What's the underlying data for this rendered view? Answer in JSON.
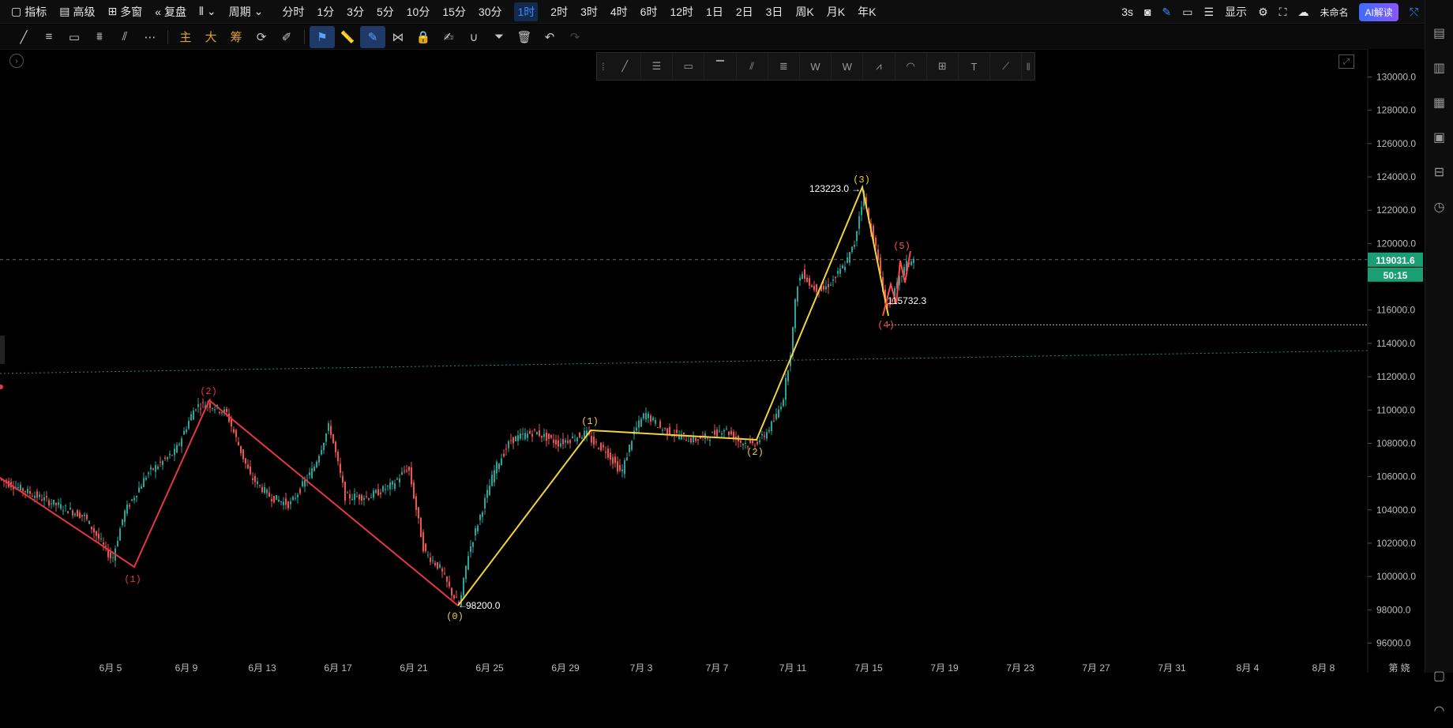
{
  "topbar": {
    "indicator": "指标",
    "advanced": "高级",
    "multiwindow": "多窗",
    "replay": "复盘",
    "period": "周期",
    "timeframes": [
      "分时",
      "1分",
      "3分",
      "5分",
      "10分",
      "15分",
      "30分",
      "1时",
      "2时",
      "3时",
      "4时",
      "6时",
      "12时",
      "1日",
      "2日",
      "3日",
      "周K",
      "月K",
      "年K"
    ],
    "active_timeframe": "1时",
    "refresh": "3s",
    "display": "显示",
    "unnamed": "未命名",
    "ai": "AI解读"
  },
  "toolbar2": {
    "main": "主",
    "big": "大",
    "chip": "筹"
  },
  "chart_data": {
    "type": "candlestick-with-elliott-waves",
    "price_axis": {
      "ticks": [
        "130000.0",
        "128000.0",
        "126000.0",
        "124000.0",
        "122000.0",
        "120000.0",
        "118000.0",
        "116000.0",
        "114000.0",
        "112000.0",
        "110000.0",
        "108000.0",
        "106000.0",
        "104000.0",
        "102000.0",
        "100000.0",
        "98000.0",
        "96000.0"
      ],
      "range": [
        95000,
        131000
      ]
    },
    "date_axis": {
      "ticks": [
        "6月 5",
        "6月 9",
        "6月 13",
        "6月 17",
        "6月 21",
        "6月 25",
        "6月 29",
        "7月 3",
        "7月 7",
        "7月 11",
        "7月 15",
        "7月 19",
        "7月 23",
        "7月 27",
        "7月 31",
        "8月 4",
        "8月 8"
      ],
      "partial_right": "第 娆"
    },
    "current_price": "119031.6",
    "countdown": "50:15",
    "annotations": {
      "high": "123223.0",
      "low": "98200.0",
      "recent_low": "115732.3"
    },
    "red_wave_labels": [
      "(1)",
      "(2)"
    ],
    "yellow_wave_labels": [
      "(0)",
      "(1)",
      "(2)",
      "(3)"
    ],
    "small_wave_labels": [
      "(4)",
      "(5)"
    ],
    "colors": {
      "up": "#26a69a",
      "down": "#ef5350",
      "yellow_wave": "#f2d33a",
      "red_wave": "#e53645",
      "price_tag": "#1a9f75"
    }
  }
}
